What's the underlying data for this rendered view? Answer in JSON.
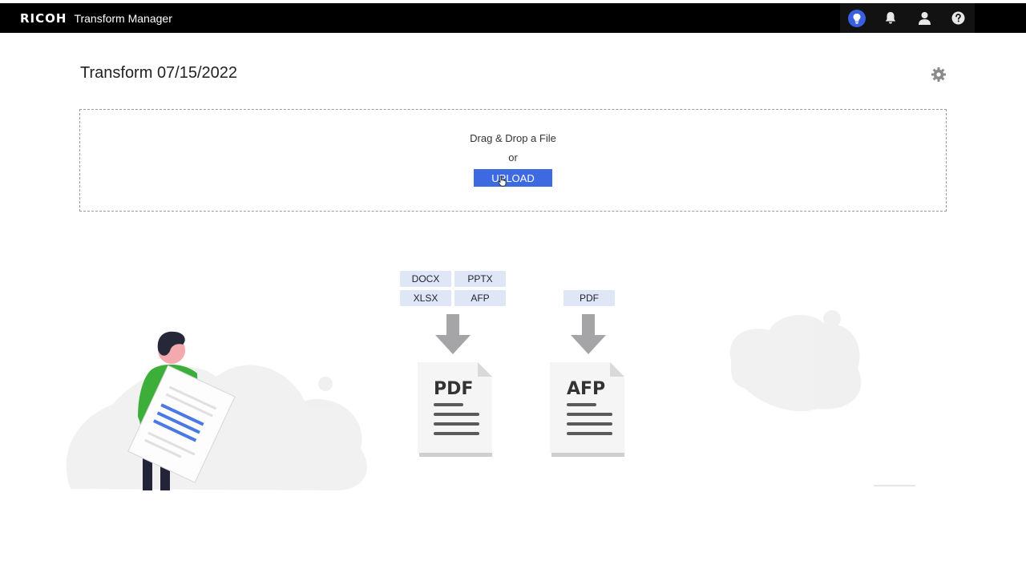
{
  "header": {
    "brand_logo": "RICOH",
    "app_name": "Transform Manager",
    "icons": [
      "lightbulb-icon",
      "bell-icon",
      "user-icon",
      "help-icon"
    ]
  },
  "page": {
    "title": "Transform 07/15/2022",
    "settings_icon": "gear-icon"
  },
  "dropzone": {
    "instruction": "Drag & Drop a File",
    "or_label": "or",
    "upload_label": "UPLOAD"
  },
  "conversions": [
    {
      "input_formats": [
        "DOCX",
        "PPTX",
        "XLSX",
        "AFP"
      ],
      "output_format": "PDF"
    },
    {
      "input_formats": [
        "PDF"
      ],
      "output_format": "AFP"
    }
  ],
  "colors": {
    "accent": "#3d6ae0",
    "header_bg": "#000000",
    "chip_bg": "#dfe7f7",
    "figure_shirt": "#3cae3a"
  }
}
